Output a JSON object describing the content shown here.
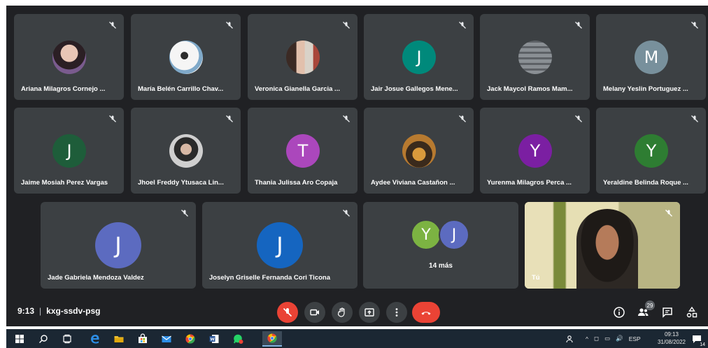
{
  "meeting": {
    "time": "9:13",
    "separator": "|",
    "code": "kxg-ssdv-psg"
  },
  "participants_row1": [
    {
      "name": "Ariana Milagros Cornejo ...",
      "avatar": "photo"
    },
    {
      "name": "María Belén Carrillo Chav...",
      "avatar": "photo"
    },
    {
      "name": "Veronica Gianella Garcia ...",
      "avatar": "photo"
    },
    {
      "name": "Jair Josue Gallegos Mene...",
      "avatar": "letter",
      "letter": "J",
      "color": "#00897b"
    },
    {
      "name": "Jack Maycol Ramos Mam...",
      "avatar": "photo"
    },
    {
      "name": "Melany Yeslin Portuguez ...",
      "avatar": "letter",
      "letter": "M",
      "color": "#78909c"
    }
  ],
  "participants_row2": [
    {
      "name": "Jaime Mosiah Perez Vargas",
      "avatar": "letter",
      "letter": "J",
      "color": "#1e5d3a"
    },
    {
      "name": "Jhoel Freddy Ytusaca Lin...",
      "avatar": "photo"
    },
    {
      "name": "Thania Julissa Aro Copaja",
      "avatar": "letter",
      "letter": "T",
      "color": "#ab47bc"
    },
    {
      "name": "Aydee Viviana Castañon ...",
      "avatar": "photo"
    },
    {
      "name": "Yurenma Milagros Perca ...",
      "avatar": "letter",
      "letter": "Y",
      "color": "#7b1fa2"
    },
    {
      "name": "Yeraldine Belinda Roque ...",
      "avatar": "letter",
      "letter": "Y",
      "color": "#2e7d32"
    }
  ],
  "participants_row3": [
    {
      "name": "Jade Gabriela Mendoza Valdez",
      "avatar": "letter",
      "letter": "J",
      "color": "#5c6bc0"
    },
    {
      "name": "Joselyn Griselle Fernanda Cori Ticona",
      "avatar": "letter",
      "letter": "J",
      "color": "#1565c0"
    }
  ],
  "more": {
    "avatar1_letter": "Y",
    "avatar1_color": "#7cb342",
    "avatar2_letter": "J",
    "avatar2_color": "#5c6bc0",
    "label": "14 más"
  },
  "self_tile": {
    "name": "Tú"
  },
  "controls": {
    "mic": "mic-off-icon",
    "camera": "camera-icon",
    "raise_hand": "hand-icon",
    "present": "present-icon",
    "more": "more-vert-icon",
    "end_call": "end-call-icon"
  },
  "right_controls": {
    "participants_count": "29"
  },
  "taskbar": {
    "language": "ESP",
    "time": "09:13",
    "date": "31/08/2022",
    "notification_count": "14"
  },
  "colors": {
    "meet_bg": "#202124",
    "tile_bg": "#3c4043",
    "danger": "#ea4335"
  }
}
